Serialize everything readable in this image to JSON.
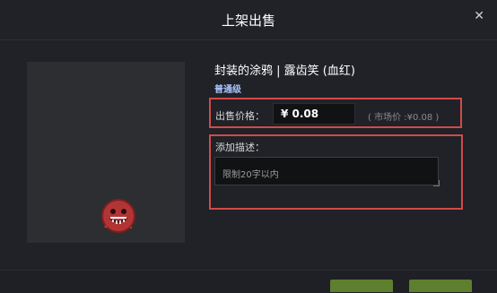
{
  "dialog": {
    "title": "上架出售",
    "close_icon": "close-icon"
  },
  "item": {
    "name": "封装的涂鸦 | 露齿笑 (血红)",
    "rarity": "普通级",
    "rarity_color": "#a9c5ff"
  },
  "price": {
    "label": "出售价格：",
    "value": "¥ 0.08",
    "market": "( 市场价 :¥0.08 )"
  },
  "description": {
    "label": "添加描述：",
    "placeholder": "限制20字以内"
  },
  "footer": {
    "left_text": "",
    "confirm_label": "",
    "secondary_label": ""
  },
  "colors": {
    "highlight_border": "#d24a4a",
    "accent_green": "#5e7f2e"
  }
}
